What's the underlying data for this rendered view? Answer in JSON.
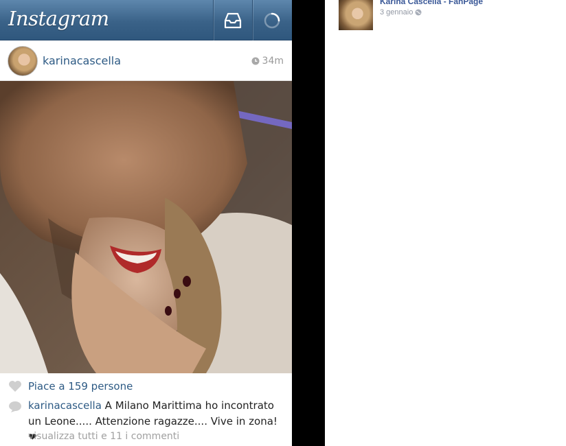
{
  "instagram": {
    "logo": "Instagram",
    "post": {
      "username": "karinacascella",
      "time": "34m",
      "likes": "Piace a 159 persone",
      "caption_user": "karinacascella",
      "caption": " A Milano Marittima ho incontrato un Leone..... Attenzione ragazze.... Vive in zona! ❤",
      "view_all_comments": "visualizza tutti e 11 i commenti"
    },
    "icons": {
      "inbox": "inbox-tray-icon",
      "refresh": "loading-spinner-icon",
      "clock": "clock-icon",
      "like": "heart-icon",
      "comment": "comment-bubble-icon"
    },
    "colors": {
      "header": "#3a6288",
      "link": "#2d5a84"
    }
  },
  "facebook": {
    "page_name": "Karina Cascella - FanPage",
    "date": "3 gennaio",
    "privacy_icon": "globe-icon",
    "colors": {
      "name": "#3b5998",
      "meta": "#9197a3"
    }
  }
}
